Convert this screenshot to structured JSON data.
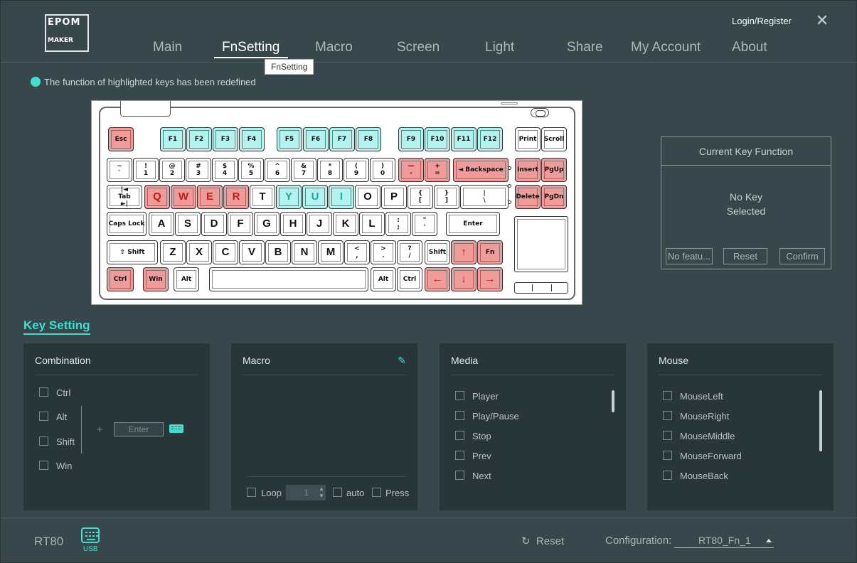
{
  "header": {
    "logo": "EPOMAKER",
    "login": "Login/Register",
    "close_icon": "close-icon",
    "tabs": [
      "Main",
      "FnSetting",
      "Macro",
      "Screen",
      "Light",
      "Share",
      "My Account",
      "About"
    ],
    "active_tab": "FnSetting",
    "tooltip": "FnSetting"
  },
  "notice": "The function of highlighted keys has been redefined",
  "colors": {
    "accent": "#3fe0d0",
    "remapped": "#f19a9a",
    "fn_keys": "#b2f2ef",
    "background": "#37474c",
    "panel": "#28363a"
  },
  "keyboard": {
    "keys": [
      {
        "label": "Esc",
        "style": "red"
      },
      {
        "label": "F1",
        "style": "cyan"
      },
      {
        "label": "F2",
        "style": "cyan"
      },
      {
        "label": "F3",
        "style": "cyan"
      },
      {
        "label": "F4",
        "style": "cyan"
      },
      {
        "label": "F5",
        "style": "cyan"
      },
      {
        "label": "F6",
        "style": "cyan"
      },
      {
        "label": "F7",
        "style": "cyan"
      },
      {
        "label": "F8",
        "style": "cyan"
      },
      {
        "label": "F9",
        "style": "cyan"
      },
      {
        "label": "F10",
        "style": "cyan"
      },
      {
        "label": "F11",
        "style": "cyan"
      },
      {
        "label": "F12",
        "style": "cyan"
      },
      {
        "label": "Print",
        "style": ""
      },
      {
        "label": "Scroll",
        "style": ""
      },
      {
        "label": "~\n`",
        "style": ""
      },
      {
        "label": "!\n1",
        "style": ""
      },
      {
        "label": "@\n2",
        "style": ""
      },
      {
        "label": "#\n3",
        "style": ""
      },
      {
        "label": "$\n4",
        "style": ""
      },
      {
        "label": "%\n5",
        "style": ""
      },
      {
        "label": "^\n6",
        "style": ""
      },
      {
        "label": "&\n7",
        "style": ""
      },
      {
        "label": "*\n8",
        "style": ""
      },
      {
        "label": "(\n9",
        "style": ""
      },
      {
        "label": ")\n0",
        "style": ""
      },
      {
        "label": "—\n-",
        "style": "red"
      },
      {
        "label": "+\n=",
        "style": "red"
      },
      {
        "label": "◄ Backspace",
        "style": "red"
      },
      {
        "label": "Insert",
        "style": "red"
      },
      {
        "label": "PgUp",
        "style": "red"
      },
      {
        "label": "|◄\nTab\n►|",
        "style": ""
      },
      {
        "label": "Q",
        "style": "red big"
      },
      {
        "label": "W",
        "style": "red big"
      },
      {
        "label": "E",
        "style": "red big"
      },
      {
        "label": "R",
        "style": "red big"
      },
      {
        "label": "T",
        "style": "big"
      },
      {
        "label": "Y",
        "style": "cyan big"
      },
      {
        "label": "U",
        "style": "cyan big"
      },
      {
        "label": "I",
        "style": "cyan big"
      },
      {
        "label": "O",
        "style": "big"
      },
      {
        "label": "P",
        "style": "big"
      },
      {
        "label": "{\n[",
        "style": ""
      },
      {
        "label": "}\n]",
        "style": ""
      },
      {
        "label": "|\n\\",
        "style": ""
      },
      {
        "label": "Delete",
        "style": "red"
      },
      {
        "label": "PgDn",
        "style": "red"
      },
      {
        "label": "Caps Lock",
        "style": ""
      },
      {
        "label": "A",
        "style": "big"
      },
      {
        "label": "S",
        "style": "big"
      },
      {
        "label": "D",
        "style": "big"
      },
      {
        "label": "F",
        "style": "big"
      },
      {
        "label": "G",
        "style": "big"
      },
      {
        "label": "H",
        "style": "big"
      },
      {
        "label": "J",
        "style": "big"
      },
      {
        "label": "K",
        "style": "big"
      },
      {
        "label": "L",
        "style": "big"
      },
      {
        "label": ":\n;",
        "style": ""
      },
      {
        "label": "\"\n'",
        "style": ""
      },
      {
        "label": "Enter",
        "style": ""
      },
      {
        "label": "⇧ Shift",
        "style": ""
      },
      {
        "label": "Z",
        "style": "big"
      },
      {
        "label": "X",
        "style": "big"
      },
      {
        "label": "C",
        "style": "big"
      },
      {
        "label": "V",
        "style": "big"
      },
      {
        "label": "B",
        "style": "big"
      },
      {
        "label": "N",
        "style": "big"
      },
      {
        "label": "M",
        "style": "big"
      },
      {
        "label": "<\n,",
        "style": ""
      },
      {
        "label": ">\n.",
        "style": ""
      },
      {
        "label": "?\n/",
        "style": ""
      },
      {
        "label": "Shift",
        "style": ""
      },
      {
        "label": "↑",
        "style": "red big"
      },
      {
        "label": "Fn",
        "style": "red"
      },
      {
        "label": "Ctrl",
        "style": "red"
      },
      {
        "label": "Win",
        "style": "red"
      },
      {
        "label": "Alt",
        "style": ""
      },
      {
        "label": "Alt",
        "style": ""
      },
      {
        "label": "Ctrl",
        "style": ""
      },
      {
        "label": "←",
        "style": "red big"
      },
      {
        "label": "↓",
        "style": "red big"
      },
      {
        "label": "→",
        "style": "red big"
      }
    ]
  },
  "current_key": {
    "title": "Current Key Function",
    "message": "No Key\nSelected",
    "buttons": [
      "No featu...",
      "Reset",
      "Confirm"
    ]
  },
  "key_setting": {
    "title": "Key Setting",
    "combination": {
      "title": "Combination",
      "modifiers": [
        "Ctrl",
        "Alt",
        "Shift",
        "Win"
      ],
      "plus": "+",
      "input_placeholder": "Enter"
    },
    "macro": {
      "title": "Macro",
      "loop_label": "Loop",
      "loop_value": "1",
      "auto_label": "auto",
      "press_label": "Press"
    },
    "media": {
      "title": "Media",
      "items": [
        "Player",
        "Play/Pause",
        "Stop",
        "Prev",
        "Next"
      ]
    },
    "mouse": {
      "title": "Mouse",
      "items": [
        "MouseLeft",
        "MouseRight",
        "MouseMiddle",
        "MouseForward",
        "MouseBack"
      ]
    }
  },
  "footer": {
    "model": "RT80",
    "connection": "USB",
    "reset": "Reset",
    "config_label": "Configuration:",
    "config_value": "RT80_Fn_1"
  }
}
